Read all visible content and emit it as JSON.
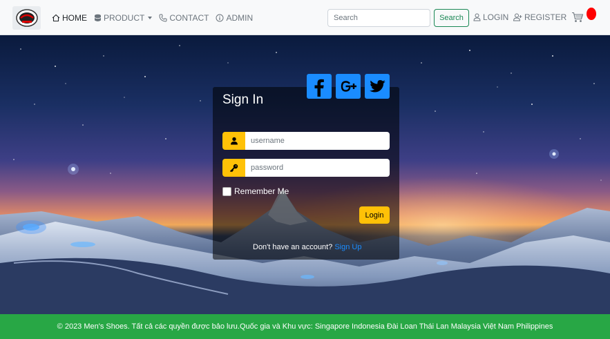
{
  "nav": {
    "home": "HOME",
    "product": "PRODUCT",
    "contact": "CONTACT",
    "admin": "ADMIN"
  },
  "search": {
    "placeholder": "Search",
    "button": "Search"
  },
  "auth": {
    "login": "LOGIN",
    "register": "REGISTER"
  },
  "login_form": {
    "title": "Sign In",
    "username_placeholder": "username",
    "password_placeholder": "password",
    "remember_label": "Remember Me",
    "submit_label": "Login",
    "signup_prompt": "Don't have an account?",
    "signup_link": "Sign Up"
  },
  "footer": {
    "text": "© 2023 Men's Shoes. Tất cả các quyền được bảo lưu.Quốc gia và Khu vực: Singapore Indonesia Đài Loan Thái Lan Malaysia Việt Nam Philippines"
  },
  "icons": {
    "logo": "brand-logo",
    "home": "home-icon",
    "product": "database-icon",
    "contact": "telephone-icon",
    "admin": "info-icon",
    "login": "person-icon",
    "register": "person-plus-icon",
    "cart": "cart-icon",
    "facebook": "facebook-icon",
    "google_plus": "google-plus-icon",
    "twitter": "twitter-icon",
    "user": "user-icon",
    "key": "key-icon"
  },
  "colors": {
    "accent_yellow": "#ffc107",
    "social_blue": "#1a8cff",
    "footer_green": "#28a745",
    "search_green": "#198754",
    "cart_badge": "#ff0000"
  }
}
